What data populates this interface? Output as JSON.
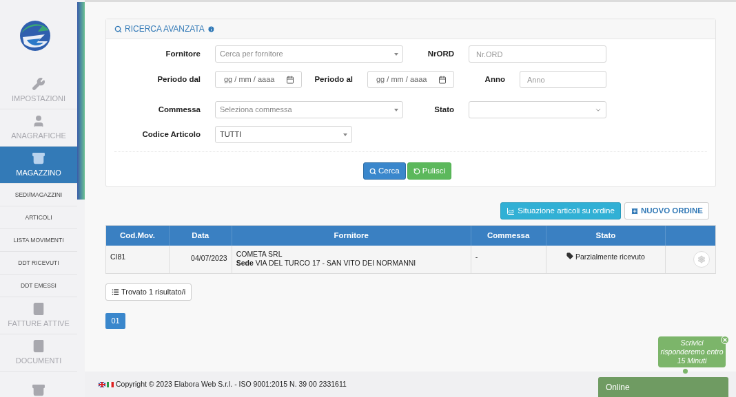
{
  "sidebar": {
    "items": [
      {
        "kind": "main",
        "label": "IMPOSTAZIONI",
        "selected": false
      },
      {
        "kind": "main",
        "label": "ANAGRAFICHE",
        "selected": false
      },
      {
        "kind": "main",
        "label": "MAGAZZINO",
        "selected": true
      },
      {
        "kind": "sub",
        "label": "SEDI/MAGAZZINI",
        "selected": false
      },
      {
        "kind": "sub",
        "label": "ARTICOLI",
        "selected": false
      },
      {
        "kind": "sub",
        "label": "LISTA MOVIMENTI",
        "selected": false
      },
      {
        "kind": "sub",
        "label": "DDT RICEVUTI",
        "selected": false
      },
      {
        "kind": "sub",
        "label": "DDT EMESSI",
        "selected": false
      },
      {
        "kind": "main",
        "label": "FATTURE ATTIVE",
        "selected": false
      },
      {
        "kind": "main",
        "label": "DOCUMENTI",
        "selected": false
      },
      {
        "kind": "main",
        "selected": false
      }
    ]
  },
  "search_panel": {
    "title": "RICERCA AVANZATA",
    "rows": [
      [
        {
          "label": "Fornitore",
          "kind": "select",
          "placeholder": "Cerca per fornitore"
        },
        {
          "label": "NrORD",
          "kind": "text",
          "placeholder": "Nr.ORD"
        }
      ],
      [
        {
          "label": "Periodo dal",
          "kind": "date",
          "placeholder": "gg / mm / aaaa"
        },
        {
          "label": "Periodo al",
          "kind": "date",
          "placeholder": "gg / mm / aaaa"
        },
        {
          "label": "Anno",
          "kind": "text",
          "placeholder": "Anno"
        }
      ],
      [
        {
          "label": "Commessa",
          "kind": "select",
          "placeholder": "Seleziona commessa"
        },
        {
          "label": "Stato",
          "kind": "native-select"
        }
      ],
      [
        {
          "label": "Codice Articolo",
          "kind": "select",
          "value": "TUTTI"
        }
      ]
    ],
    "buttons": [
      {
        "label": "Cerca",
        "kind": "primary"
      },
      {
        "label": "Pulisci",
        "kind": "success"
      }
    ]
  },
  "actions": [
    {
      "label": "Situazione articoli su ordine",
      "kind": "info"
    },
    {
      "label": "NUOVO ORDINE",
      "kind": "default"
    }
  ],
  "table": {
    "columns": [
      "Cod.Mov.",
      "Data",
      "Fornitore",
      "Commessa",
      "Stato"
    ],
    "rows": [
      {
        "cod": "CI81",
        "data": "04/07/2023",
        "fornitore": "COMETA SRL",
        "sede": "**Sede** VIA DEL TURCO 17 - SAN VITO DEI NORMANNI",
        "commessa": "-",
        "stato": "Parzialmente ricevuto"
      }
    ]
  },
  "result_count": "Trovato 1 risultato/i",
  "pagination": [
    {
      "label": "01",
      "selected": true
    }
  ],
  "footer": {
    "copyright": "Copyright © 2023 Elabora Web S.r.l. - ISO 9001:2015 N. 39 00 2331611"
  },
  "chat": {
    "bubble": "Scrivici risponderemo entro 15 Minuti",
    "status": "Online"
  }
}
